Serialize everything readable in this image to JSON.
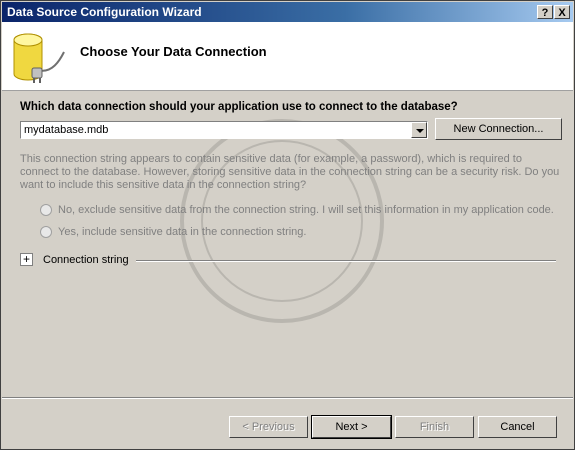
{
  "window": {
    "title": "Data Source Configuration Wizard",
    "help_label": "?",
    "close_label": "X"
  },
  "header": {
    "title": "Choose Your Data Connection",
    "icon": "database-plug-icon"
  },
  "connection": {
    "question": "Which data connection should your application use to connect to the database?",
    "selected": "mydatabase.mdb",
    "new_connection_label": "New Connection..."
  },
  "sensitive": {
    "message": "This connection string appears to contain sensitive data (for example, a password), which is required to connect to the database. However, storing sensitive data in the connection string can be a security risk. Do you want to include this sensitive data in the connection string?",
    "options": [
      {
        "label": "No, exclude sensitive data from the connection string. I will set this information in my application code."
      },
      {
        "label": "Yes, include sensitive data in the connection string."
      }
    ]
  },
  "connection_string": {
    "expander": "+",
    "label": "Connection string"
  },
  "footer": {
    "previous": "< Previous",
    "next": "Next >",
    "finish": "Finish",
    "cancel": "Cancel"
  }
}
